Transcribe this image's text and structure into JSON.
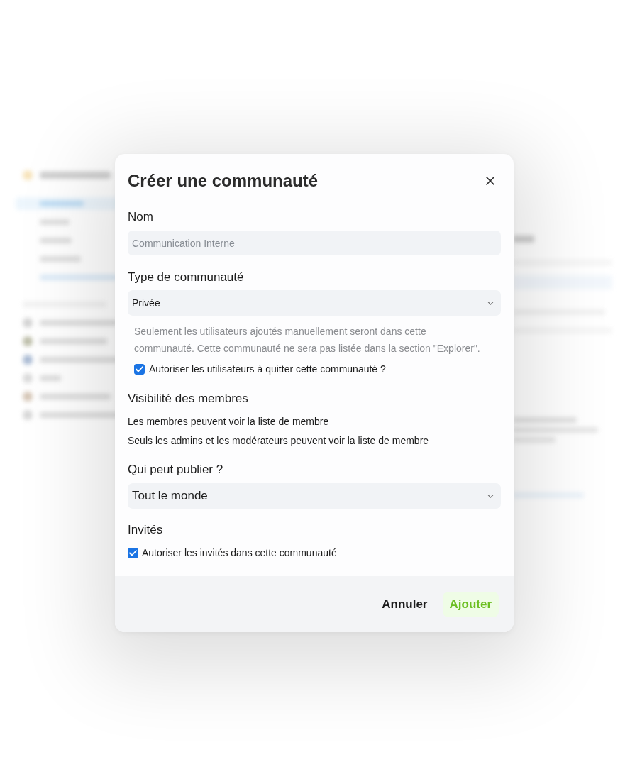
{
  "dialog": {
    "title": "Créer une communauté"
  },
  "name_field": {
    "label": "Nom",
    "placeholder": "Communication Interne"
  },
  "type_field": {
    "label": "Type de communauté",
    "value": "Privée",
    "description": "Seulement les utilisateurs ajoutés manuellement seront dans cette communauté. Cette communauté ne sera pas listée dans la section \"Explorer\".",
    "allow_leave": {
      "label": "Autoriser les utilisateurs à quitter cette communauté ?",
      "checked": true
    }
  },
  "member_visibility": {
    "label": "Visibilité des membres",
    "options": [
      "Les membres peuvent voir la liste de membre",
      "Seuls les admins et les modérateurs peuvent voir la liste de membre"
    ]
  },
  "publish_field": {
    "label": "Qui peut publier ?",
    "value": "Tout le monde"
  },
  "guests": {
    "label": "Invités",
    "allow_guests": {
      "label": "Autoriser les invités dans cette communauté",
      "checked": true
    }
  },
  "buttons": [
    {
      "label": "Annuler",
      "kind": "secondary"
    },
    {
      "label": "Ajouter",
      "kind": "primary"
    }
  ]
}
